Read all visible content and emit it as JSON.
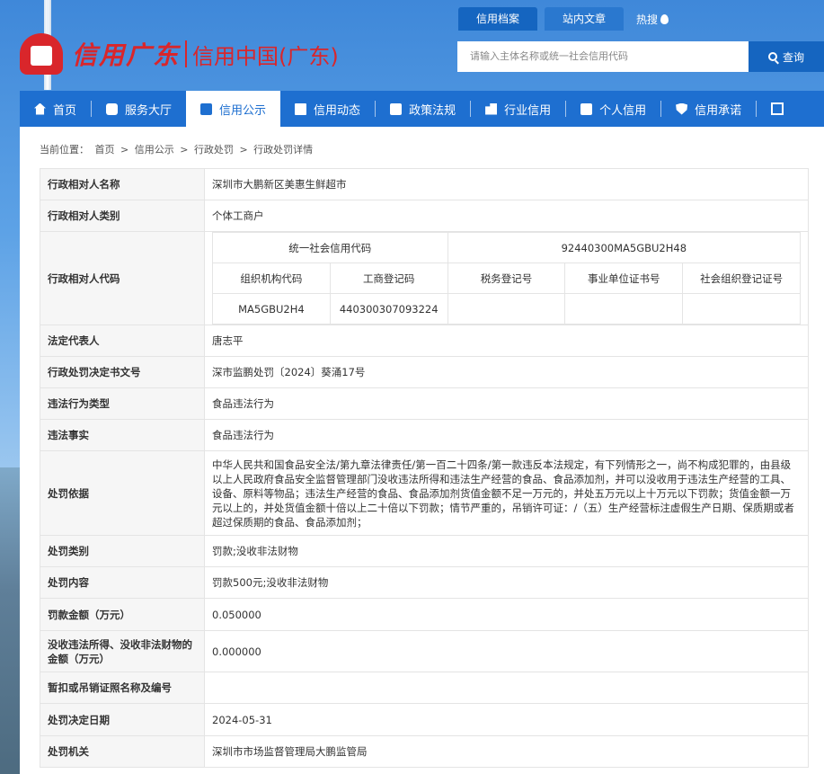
{
  "header": {
    "logo_text": "信用广东",
    "logo_sub": "信用中国(广东)",
    "top_tabs": [
      "信用档案",
      "站内文章"
    ],
    "hot_label": "热搜",
    "search_placeholder": "请输入主体名称或统一社会信用代码",
    "search_button": "查询"
  },
  "nav": {
    "items": [
      {
        "label": "首页",
        "icon": "home-icon"
      },
      {
        "label": "服务大厅",
        "icon": "grid-icon"
      },
      {
        "label": "信用公示",
        "icon": "notice-icon",
        "active": true
      },
      {
        "label": "信用动态",
        "icon": "news-icon"
      },
      {
        "label": "政策法规",
        "icon": "book-icon"
      },
      {
        "label": "行业信用",
        "icon": "building-icon"
      },
      {
        "label": "个人信用",
        "icon": "person-icon"
      },
      {
        "label": "信用承诺",
        "icon": "shield-icon"
      }
    ],
    "expand_icon": "expand-icon"
  },
  "breadcrumb": {
    "prefix": "当前位置：",
    "items": [
      "首页",
      "信用公示",
      "行政处罚",
      "行政处罚详情"
    ],
    "sep": ">"
  },
  "detail": {
    "rows": [
      {
        "label": "行政相对人名称",
        "value": "深圳市大鹏新区美惠生鲜超市"
      },
      {
        "label": "行政相对人类别",
        "value": "个体工商户"
      },
      {
        "label": "行政相对人代码"
      },
      {
        "label": "法定代表人",
        "value": "唐志平"
      },
      {
        "label": "行政处罚决定书文号",
        "value": "深市监鹏处罚〔2024〕葵涌17号"
      },
      {
        "label": "违法行为类型",
        "value": "食品违法行为"
      },
      {
        "label": "违法事实",
        "value": "食品违法行为"
      },
      {
        "label": "处罚依据",
        "value": "中华人民共和国食品安全法/第九章法律责任/第一百二十四条/第一款违反本法规定，有下列情形之一，尚不构成犯罪的，由县级以上人民政府食品安全监督管理部门没收违法所得和违法生产经营的食品、食品添加剂，并可以没收用于违法生产经营的工具、设备、原料等物品；违法生产经营的食品、食品添加剂货值金额不足一万元的，并处五万元以上十万元以下罚款；货值金额一万元以上的，并处货值金额十倍以上二十倍以下罚款；情节严重的，吊销许可证：/（五）生产经营标注虚假生产日期、保质期或者超过保质期的食品、食品添加剂；"
      },
      {
        "label": "处罚类别",
        "value": "罚款;没收非法财物"
      },
      {
        "label": "处罚内容",
        "value": "罚款500元;没收非法财物"
      },
      {
        "label": "罚款金额（万元）",
        "value": "0.050000"
      },
      {
        "label": "没收违法所得、没收非法财物的金额（万元）",
        "value": "0.000000"
      },
      {
        "label": "暂扣或吊销证照名称及编号",
        "value": ""
      },
      {
        "label": "处罚决定日期",
        "value": "2024-05-31"
      },
      {
        "label": "处罚机关",
        "value": "深圳市市场监督管理局大鹏监管局"
      }
    ],
    "code": {
      "uscc_label": "统一社会信用代码",
      "uscc_value": "92440300MA5GBU2H48",
      "headers": [
        "组织机构代码",
        "工商登记码",
        "税务登记号",
        "事业单位证书号",
        "社会组织登记证号"
      ],
      "values": [
        "MA5GBU2H4",
        "440300307093224",
        "",
        "",
        ""
      ]
    }
  }
}
